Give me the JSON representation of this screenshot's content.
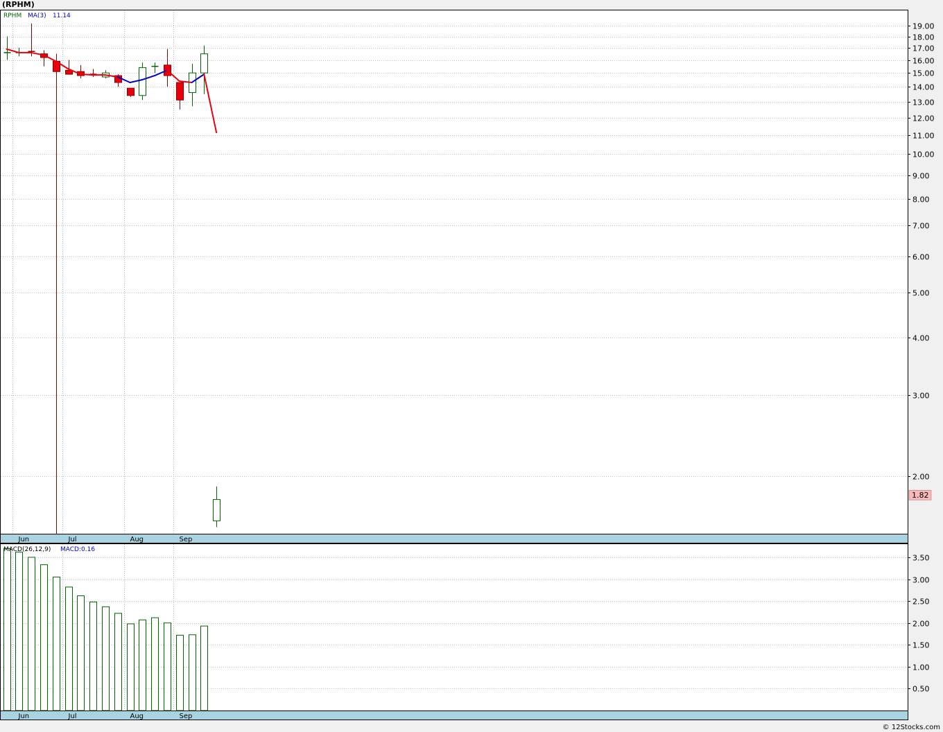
{
  "page": {
    "title": "(RPHM)",
    "footer": "© 12Stocks.com"
  },
  "price_panel": {
    "ticker_label": "RPHM",
    "ma_label": "MA(3)",
    "ma_value": "11.14",
    "last_price_label": "1.82",
    "months": [
      {
        "label": "Jun",
        "index": 1
      },
      {
        "label": "Jul",
        "index": 5
      },
      {
        "label": "Aug",
        "index": 10
      },
      {
        "label": "Sep",
        "index": 14
      }
    ]
  },
  "macd_panel": {
    "indicator_label": "MACD(26,12,9)",
    "macd_label": "MACD:0.16"
  },
  "colors": {
    "up": "#006400",
    "down": "#e8000b",
    "ma_up": "#0000cc",
    "ma_down": "#e8000b",
    "axis_band": "#a9d3e0",
    "last_price_bg": "#f7b9b9"
  },
  "chart_data": [
    {
      "type": "candlestick",
      "scale": "log",
      "ylim": [
        1.5,
        20.5
      ],
      "y_ticks": [
        2,
        3,
        4,
        5,
        6,
        7,
        8,
        9,
        10,
        11,
        12,
        13,
        14,
        15,
        16,
        17,
        18,
        19
      ],
      "grid": true,
      "candles": [
        {
          "o": 16.6,
          "h": 18.0,
          "l": 16.0,
          "c": 16.6
        },
        {
          "o": 16.6,
          "h": 17.0,
          "l": 16.3,
          "c": 16.6
        },
        {
          "o": 16.7,
          "h": 19.2,
          "l": 16.3,
          "c": 16.6
        },
        {
          "o": 16.5,
          "h": 16.8,
          "l": 15.5,
          "c": 16.2
        },
        {
          "o": 15.9,
          "h": 16.5,
          "l": 1.5,
          "c": 15.1
        },
        {
          "o": 15.2,
          "h": 16.0,
          "l": 14.9,
          "c": 14.9
        },
        {
          "o": 15.1,
          "h": 15.6,
          "l": 14.6,
          "c": 14.8
        },
        {
          "o": 14.9,
          "h": 15.3,
          "l": 14.7,
          "c": 14.85
        },
        {
          "o": 14.7,
          "h": 15.2,
          "l": 14.6,
          "c": 15.0
        },
        {
          "o": 14.8,
          "h": 14.9,
          "l": 14.0,
          "c": 14.3
        },
        {
          "o": 13.9,
          "h": 13.9,
          "l": 13.3,
          "c": 13.4
        },
        {
          "o": 13.4,
          "h": 15.8,
          "l": 13.1,
          "c": 15.4
        },
        {
          "o": 15.4,
          "h": 15.8,
          "l": 15.0,
          "c": 15.5
        },
        {
          "o": 15.6,
          "h": 16.9,
          "l": 14.0,
          "c": 14.8
        },
        {
          "o": 14.3,
          "h": 14.3,
          "l": 12.5,
          "c": 13.1
        },
        {
          "o": 13.6,
          "h": 15.7,
          "l": 12.7,
          "c": 15.0
        },
        {
          "o": 15.0,
          "h": 17.2,
          "l": 13.5,
          "c": 16.5
        },
        {
          "o": 1.6,
          "h": 1.9,
          "l": 1.55,
          "c": 1.78
        }
      ],
      "moving_average": {
        "name": "MA(3)",
        "values": [
          16.9,
          16.6,
          16.6,
          16.4,
          15.9,
          15.3,
          14.9,
          14.85,
          14.85,
          14.7,
          14.3,
          14.5,
          14.8,
          15.2,
          14.4,
          14.3,
          14.9,
          11.14
        ],
        "rising": [
          false,
          false,
          false,
          false,
          false,
          false,
          false,
          false,
          false,
          false,
          true,
          true,
          true,
          true,
          false,
          false,
          true,
          false
        ]
      }
    },
    {
      "type": "bar",
      "name": "MACD(26,12,9)",
      "ylim": [
        0,
        3.8
      ],
      "y_ticks": [
        0.5,
        1.0,
        1.5,
        2.0,
        2.5,
        3.0,
        3.5
      ],
      "values": [
        3.7,
        3.62,
        3.5,
        3.33,
        3.05,
        2.82,
        2.62,
        2.48,
        2.37,
        2.22,
        1.98,
        2.07,
        2.12,
        2.0,
        1.72,
        1.73,
        1.93
      ]
    }
  ]
}
